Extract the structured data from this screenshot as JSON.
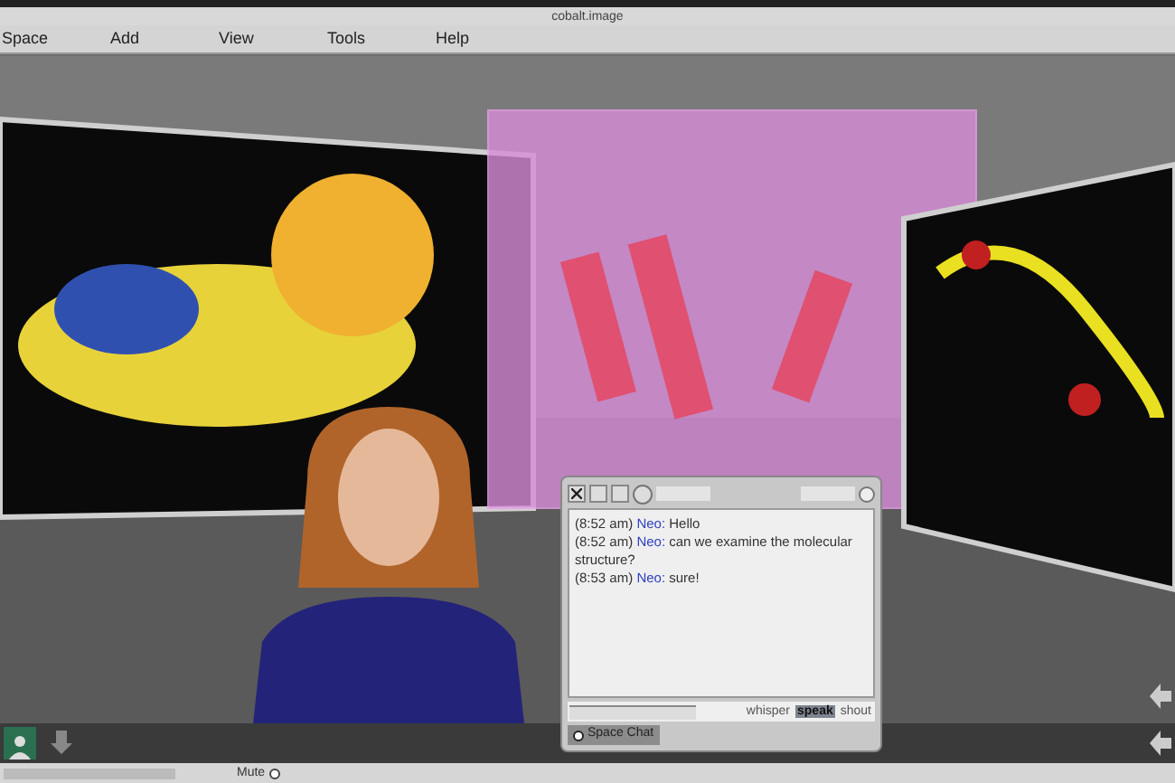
{
  "window": {
    "title": "cobalt.image"
  },
  "menu": [
    "Space",
    "Add",
    "View",
    "Tools",
    "Help"
  ],
  "chat": {
    "messages": [
      {
        "time": "(8:52 am)",
        "speaker": "Neo:",
        "text": "Hello"
      },
      {
        "time": "(8:52 am)",
        "speaker": "Neo:",
        "text": "can we examine the molecular structure?"
      },
      {
        "time": "(8:53 am)",
        "speaker": "Neo:",
        "text": "sure!"
      }
    ],
    "modes": [
      {
        "label": "whisper",
        "selected": false
      },
      {
        "label": "speak",
        "selected": true
      },
      {
        "label": "shout",
        "selected": false
      }
    ],
    "space_chat": {
      "label": "Space Chat",
      "checked": false
    }
  },
  "status_bar": {
    "mute": {
      "label": "Mute",
      "checked": false
    }
  }
}
